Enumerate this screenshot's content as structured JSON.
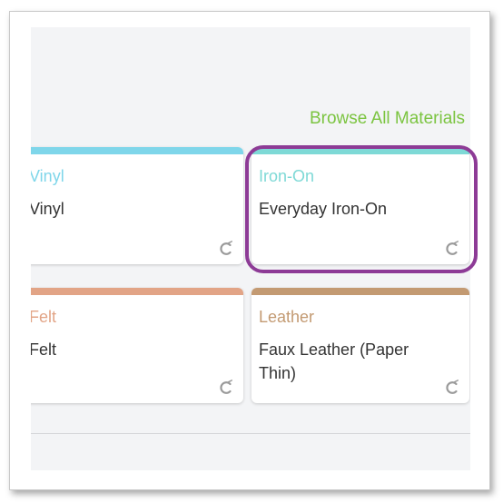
{
  "browse_link": "Browse All Materials",
  "colors": {
    "accent": "#7bc440",
    "highlight": "#8d3b96"
  },
  "cards": [
    {
      "category": "Vinyl",
      "material": "Vinyl",
      "color": "#7fd6ea",
      "icon": "cricut-c-icon"
    },
    {
      "category": "Iron-On",
      "material": "Everyday Iron-On",
      "color": "#7ed9d6",
      "icon": "cricut-c-icon"
    },
    {
      "category": "Felt",
      "material": "Felt",
      "color": "#e2a486",
      "icon": "cricut-c-icon"
    },
    {
      "category": "Leather",
      "material": "Faux Leather (Paper Thin)",
      "color": "#c39a72",
      "icon": "cricut-c-icon"
    }
  ]
}
